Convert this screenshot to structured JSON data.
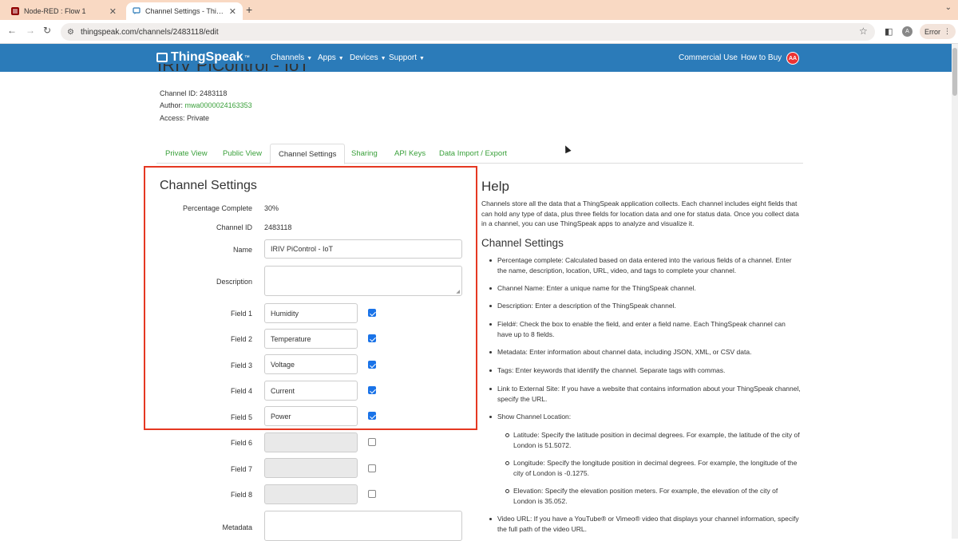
{
  "browser": {
    "tabs": [
      {
        "title": "Node-RED : Flow 1",
        "active": false
      },
      {
        "title": "Channel Settings - ThingSpeak",
        "active": true
      }
    ],
    "url": "thingspeak.com/channels/2483118/edit",
    "profile_initial": "A",
    "error_label": "Error"
  },
  "site": {
    "logo": "ThingSpeak",
    "logo_tm": "™",
    "nav": [
      {
        "label": "Channels"
      },
      {
        "label": "Apps"
      },
      {
        "label": "Devices"
      },
      {
        "label": "Support"
      }
    ],
    "right_links": [
      {
        "label": "Commercial Use"
      },
      {
        "label": "How to Buy"
      }
    ],
    "user_initials": "AA"
  },
  "channel": {
    "title": "IRIV PiControl - IoT",
    "id_line_label": "Channel ID:",
    "id": "2483118",
    "author_label": "Author:",
    "author": "mwa0000024163353",
    "access_label": "Access:",
    "access": "Private"
  },
  "page_tabs": [
    {
      "label": "Private View",
      "active": false
    },
    {
      "label": "Public View",
      "active": false
    },
    {
      "label": "Channel Settings",
      "active": true
    },
    {
      "label": "Sharing",
      "active": false
    },
    {
      "label": "API Keys",
      "active": false
    },
    {
      "label": "Data Import / Export",
      "active": false
    }
  ],
  "settings": {
    "heading": "Channel Settings",
    "percentage_label": "Percentage Complete",
    "percentage_value": "30%",
    "channel_id_label": "Channel ID",
    "channel_id_value": "2483118",
    "name_label": "Name",
    "name_value": "IRIV PiControl - IoT",
    "description_label": "Description",
    "description_value": "",
    "fields": [
      {
        "label": "Field 1",
        "value": "Humidity",
        "checked": true
      },
      {
        "label": "Field 2",
        "value": "Temperature",
        "checked": true
      },
      {
        "label": "Field 3",
        "value": "Voltage",
        "checked": true
      },
      {
        "label": "Field 4",
        "value": "Current",
        "checked": true
      },
      {
        "label": "Field 5",
        "value": "Power",
        "checked": true
      },
      {
        "label": "Field 6",
        "value": "",
        "checked": false
      },
      {
        "label": "Field 7",
        "value": "",
        "checked": false
      },
      {
        "label": "Field 8",
        "value": "",
        "checked": false
      }
    ],
    "metadata_label": "Metadata"
  },
  "help": {
    "heading": "Help",
    "intro": "Channels store all the data that a ThingSpeak application collects. Each channel includes eight fields that can hold any type of data, plus three fields for location data and one for status data. Once you collect data in a channel, you can use ThingSpeak apps to analyze and visualize it.",
    "subheading": "Channel Settings",
    "items": [
      "Percentage complete: Calculated based on data entered into the various fields of a channel. Enter the name, description, location, URL, video, and tags to complete your channel.",
      "Channel Name: Enter a unique name for the ThingSpeak channel.",
      "Description: Enter a description of the ThingSpeak channel.",
      "Field#: Check the box to enable the field, and enter a field name. Each ThingSpeak channel can have up to 8 fields.",
      "Metadata: Enter information about channel data, including JSON, XML, or CSV data.",
      "Tags: Enter keywords that identify the channel. Separate tags with commas.",
      "Link to External Site: If you have a website that contains information about your ThingSpeak channel, specify the URL.",
      "Show Channel Location:",
      "Video URL: If you have a YouTube® or Vimeo® video that displays your channel information, specify the full path of the video URL."
    ],
    "location_items": [
      "Latitude: Specify the latitude position in decimal degrees. For example, the latitude of the city of London is 51.5072.",
      "Longitude: Specify the longitude position in decimal degrees. For example, the longitude of the city of London is -0.1275.",
      "Elevation: Specify the elevation position meters. For example, the elevation of the city of London is 35.052."
    ]
  },
  "colors": {
    "nav_blue": "#2b7bb9",
    "link_green": "#39a03a",
    "highlight_red": "#e53822",
    "checkbox_blue": "#1a73e8"
  }
}
